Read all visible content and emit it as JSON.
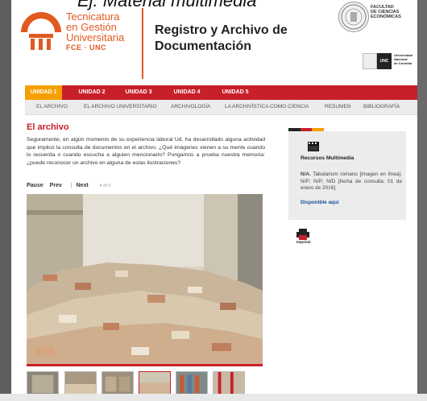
{
  "caption": "Ej. Material multimedia",
  "header": {
    "logo_lines": [
      "Tecnicatura",
      "en Gestión",
      "Universitaria"
    ],
    "logo_sub": "FCE · UNC",
    "site_title": "Registro y Archivo de Documentación",
    "faculty_lines": [
      "FACULTAD",
      "DE CIENCIAS",
      "ECONÓMICAS"
    ],
    "unc_mark": "UNC",
    "unc_sub": [
      "Universidad",
      "Nacional",
      "de Córdoba"
    ]
  },
  "nav": {
    "tabs": [
      {
        "label": "UNIDAD 1",
        "active": true
      },
      {
        "label": "UNIDAD 2",
        "active": false
      },
      {
        "label": "UNIDAD 3",
        "active": false
      },
      {
        "label": "UNIDAD 4",
        "active": false
      },
      {
        "label": "UNIDAD 5",
        "active": false
      }
    ],
    "subitems": [
      "EL ARCHIVO",
      "EL ARCHIVO UNIVERSITARIO",
      "ARCHIVOLOGÍA",
      "LA ARCHIVÍSTICA COMO CIENCIA",
      "RESUMEN",
      "BIBLIOGRAFÍA"
    ]
  },
  "main": {
    "heading": "El archivo",
    "paragraph": "Seguramente, en algún momento de su experiencia laboral Ud. ha desarrollado alguna actividad que implicó la consulta de documentos en el archivo. ¿Qué imágenes vienen a su mente cuando lo recuerda o cuando escucha a alguien mencionarlo? Pongamos a prueba nuestra memoria: ¿puede reconocer un archivo en alguna de estas ilustraciones?",
    "controls": {
      "pause": "Pause",
      "prev": "Prev",
      "separator": "|",
      "next": "Next",
      "counter": "4 of 6"
    },
    "thumbnail_count": 6
  },
  "sidebar": {
    "title": "Recursos Multimedia",
    "desc_lead": "N/A.",
    "desc_rest": " Tabularium romano [imagen en línea]. N/P; N/P; N/D [fecha de consulta: 01 de enero de 2016].",
    "link": "Disponible aquí",
    "print_label": "Imprimir"
  },
  "colors": {
    "nav_red": "#c8202a",
    "tab_active": "#f5a000",
    "accent_orange": "#e05a20",
    "link_blue": "#1a4fa0",
    "colorbar": [
      "#222222",
      "#c8202a",
      "#f5a000"
    ]
  },
  "icons": [
    "logo-icon",
    "seal-icon",
    "video-icon",
    "print-icon"
  ]
}
